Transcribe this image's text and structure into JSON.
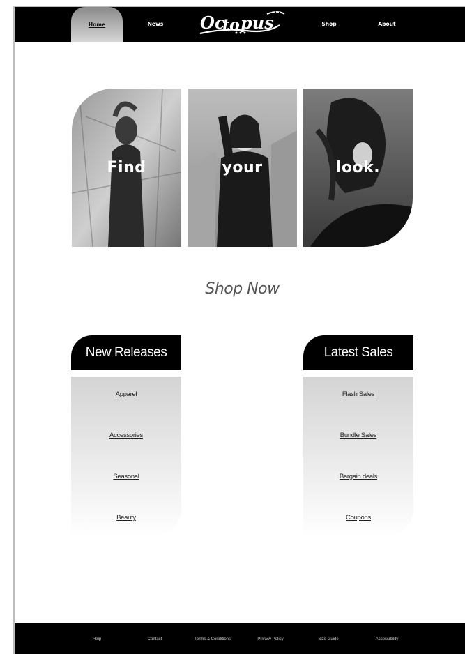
{
  "nav": {
    "home": "Home",
    "news": "News",
    "logo": "Octopus",
    "shop": "Shop",
    "about": "About"
  },
  "hero": {
    "words": [
      "Find",
      "your",
      "look."
    ]
  },
  "shop_now": "Shop Now",
  "new_releases": {
    "title": "New Releases",
    "items": [
      "Apparel",
      "Accessories",
      "Seasonal",
      "Beauty"
    ]
  },
  "latest_sales": {
    "title": "Latest Sales",
    "items": [
      "Flash Sales",
      "Bundle Sales",
      "Bargain deals",
      "Coupons"
    ]
  },
  "footer": {
    "links": [
      "Help",
      "Contact",
      "Terms & Conditions",
      "Privacy Policy",
      "Size Guide",
      "Accessibility"
    ]
  },
  "colors": {
    "bar": "#000000",
    "home_tab_top": "#8a8a8a",
    "card_gradient_top": "#d4d4d4"
  }
}
